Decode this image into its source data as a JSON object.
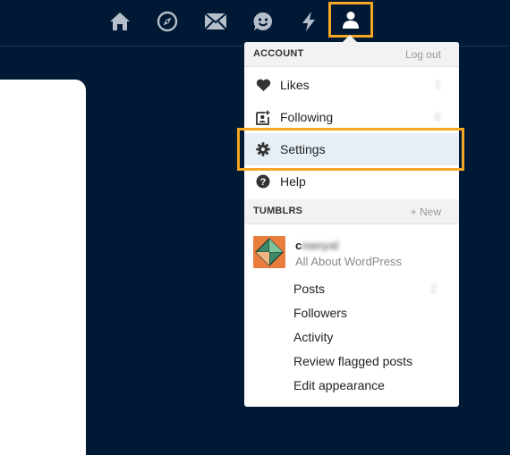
{
  "nav": {
    "icons": [
      "home-icon",
      "explore-icon",
      "inbox-icon",
      "messaging-icon",
      "activity-icon",
      "account-icon"
    ]
  },
  "account_menu": {
    "header": "ACCOUNT",
    "logout_label": "Log out",
    "items": [
      {
        "label": "Likes",
        "icon": "heart-icon",
        "count": "1"
      },
      {
        "label": "Following",
        "icon": "following-icon",
        "count": "6"
      },
      {
        "label": "Settings",
        "icon": "gear-icon"
      },
      {
        "label": "Help",
        "icon": "question-icon"
      }
    ]
  },
  "tumblrs": {
    "header": "TUMBLRS",
    "new_label": "+ New",
    "blog": {
      "name_visible": "c",
      "name_blurred": "nanyal",
      "title": "All About WordPress"
    },
    "sub_items": [
      {
        "label": "Posts",
        "count": "2"
      },
      {
        "label": "Followers"
      },
      {
        "label": "Activity"
      },
      {
        "label": "Review flagged posts"
      },
      {
        "label": "Edit appearance"
      }
    ]
  },
  "colors": {
    "background": "#001935",
    "highlight_border": "#f5a623",
    "settings_row_bg": "#e6eef6"
  }
}
